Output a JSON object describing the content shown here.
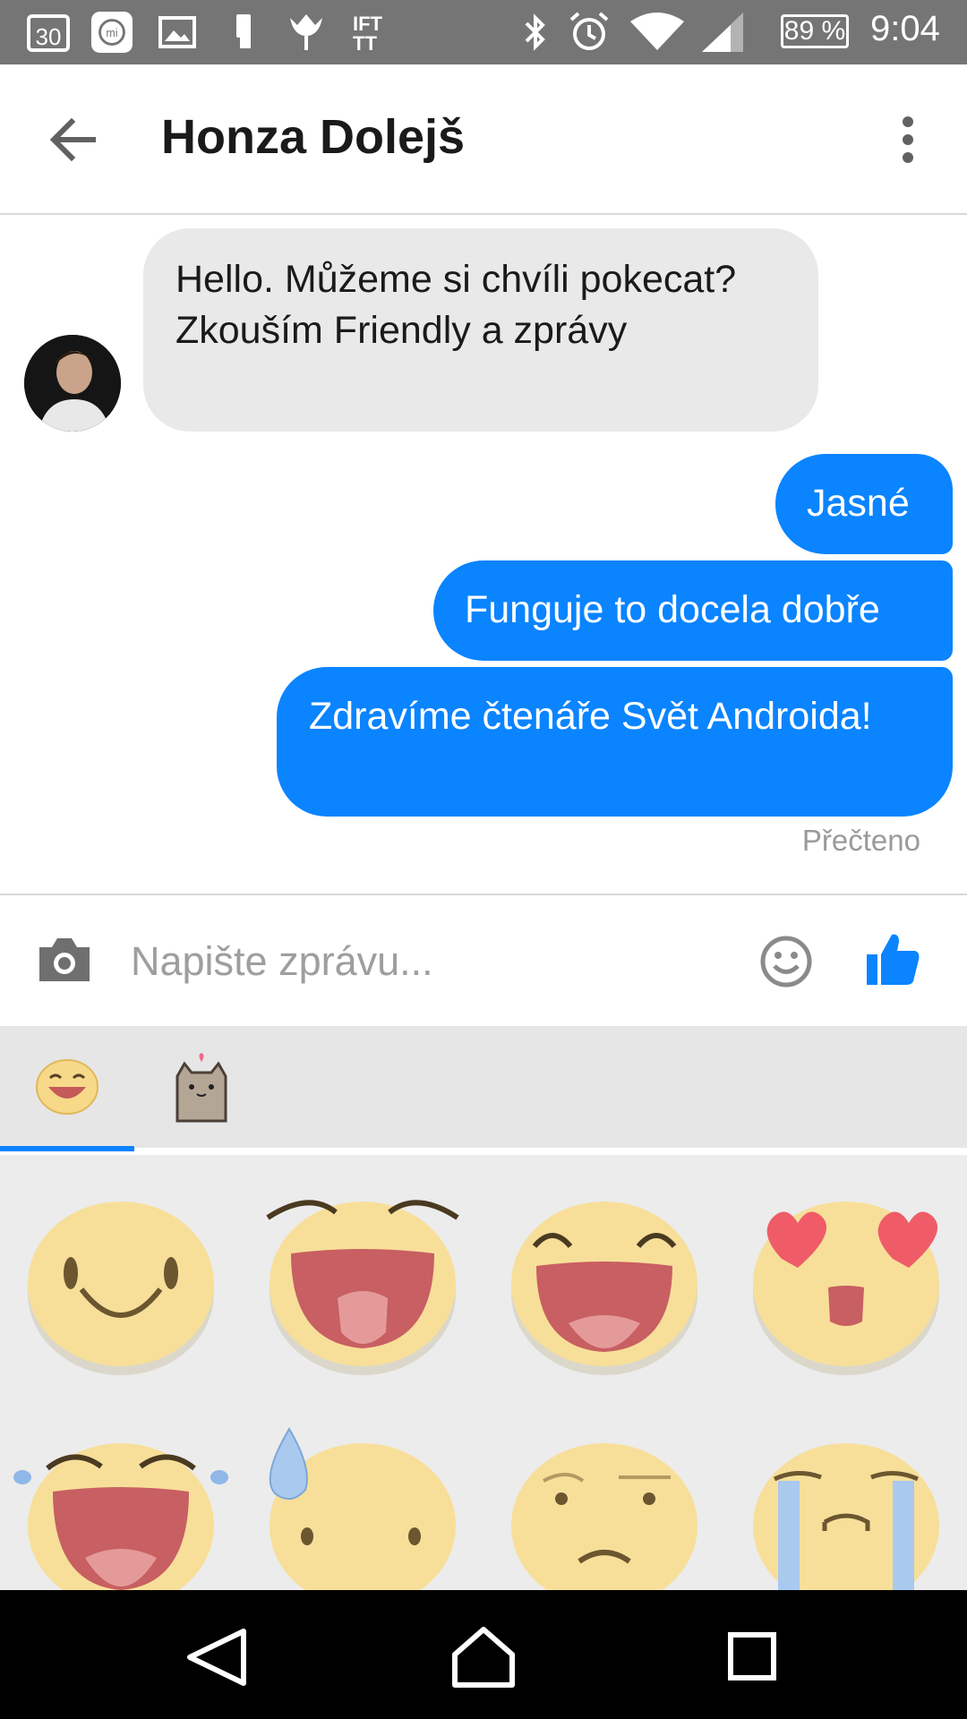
{
  "status_bar": {
    "calendar_day": "30",
    "battery_percent": "89 %",
    "time": "9:04",
    "icons": [
      "calendar-icon",
      "mi-icon",
      "gallery-icon",
      "phone-transfer-icon",
      "tulip-icon",
      "ifttt-icon",
      "bluetooth-icon",
      "alarm-icon",
      "wifi-icon",
      "signal-icon",
      "battery-icon"
    ],
    "ifttt_label": "IFTTT"
  },
  "header": {
    "title": "Honza Dolejš"
  },
  "messages": {
    "incoming_1": "Hello. Můžeme si chvíli pokecat? Zkouším Friendly a zprávy",
    "outgoing_1": "Jasné",
    "outgoing_2": "Funguje to docela dobře",
    "outgoing_3": "Zdravíme čtenáře Svět Androida!",
    "read_receipt": "Přečteno"
  },
  "composer": {
    "placeholder": "Napište zprávu..."
  },
  "sticker_tabs": [
    "emoji-faces",
    "pusheen-cat"
  ],
  "stickers": [
    "smile",
    "tongue-out",
    "happy-laugh",
    "heart-eyes",
    "tears-of-joy",
    "sweat-drop",
    "skeptical",
    "crying"
  ],
  "colors": {
    "accent": "#0a84ff",
    "status_bar": "#757575",
    "incoming_bubble": "#e9e9e9"
  }
}
